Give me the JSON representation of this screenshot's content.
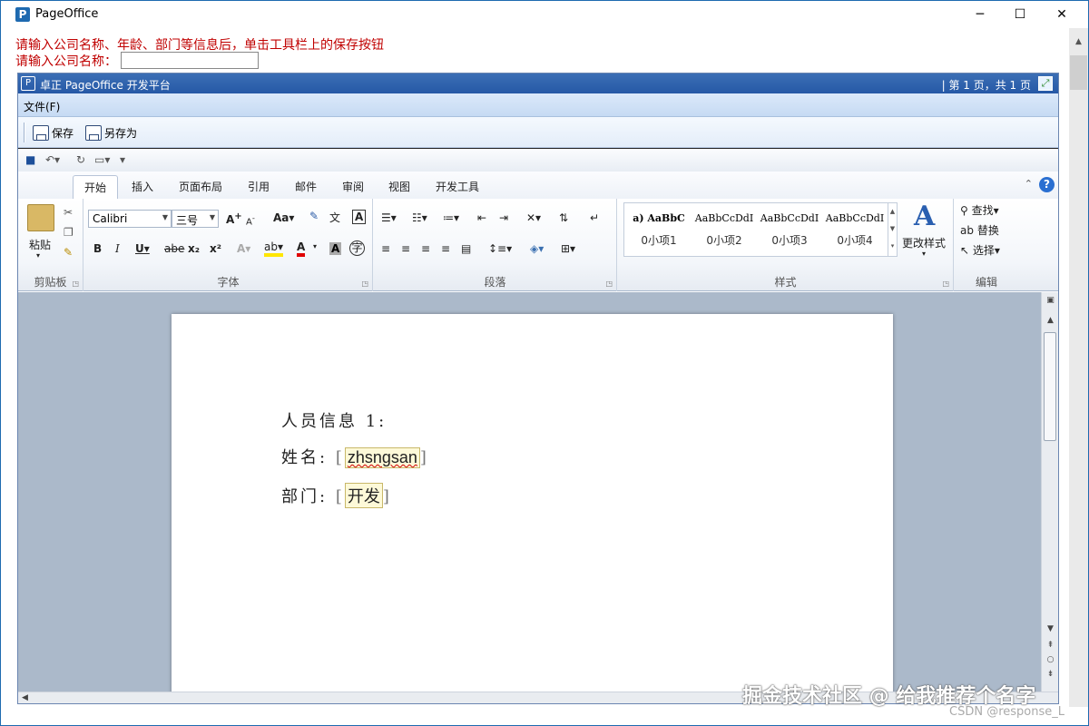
{
  "window": {
    "title": "PageOffice",
    "app_icon": "P",
    "minimize": "─",
    "maximize": "☐",
    "close": "✕"
  },
  "notice": "请输入公司名称、年龄、部门等信息后，单击工具栏上的保存按钮",
  "company": {
    "label": "请输入公司名称：",
    "value": ""
  },
  "pageoffice": {
    "title": "卓正 PageOffice 开发平台",
    "page_info": "| 第 1 页，共 1 页",
    "menu": "文件(F)",
    "toolbar": {
      "save": "保存",
      "save_as": "另存为"
    }
  },
  "word": {
    "tabs": [
      "开始",
      "插入",
      "页面布局",
      "引用",
      "邮件",
      "审阅",
      "视图",
      "开发工具"
    ],
    "active_tab": "开始",
    "groups": {
      "clipboard": "剪贴板",
      "font": "字体",
      "paragraph": "段落",
      "styles": "样式",
      "editing": "编辑"
    },
    "clipboard": {
      "paste": "粘贴"
    },
    "font": {
      "name": "Calibri",
      "size": "三号"
    },
    "styles": [
      {
        "sample": "a) AaBbC",
        "name": "0小项1"
      },
      {
        "sample": "AaBbCcDdI",
        "name": "0小项2"
      },
      {
        "sample": "AaBbCcDdI",
        "name": "0小项3"
      },
      {
        "sample": "AaBbCcDdI",
        "name": "0小项4"
      }
    ],
    "change_styles": "更改样式",
    "editing": {
      "find": "查找",
      "replace": "替换",
      "select": "选择"
    },
    "document": {
      "line1": "人员信息 1:",
      "name_label": "姓名:",
      "name_value": "zhsngsan",
      "dept_label": "部门:",
      "dept_value": "开发"
    }
  },
  "watermarks": {
    "juejin": "掘金技术社区 @ 给我推荐个名字",
    "csdn": "CSDN @response_L"
  }
}
